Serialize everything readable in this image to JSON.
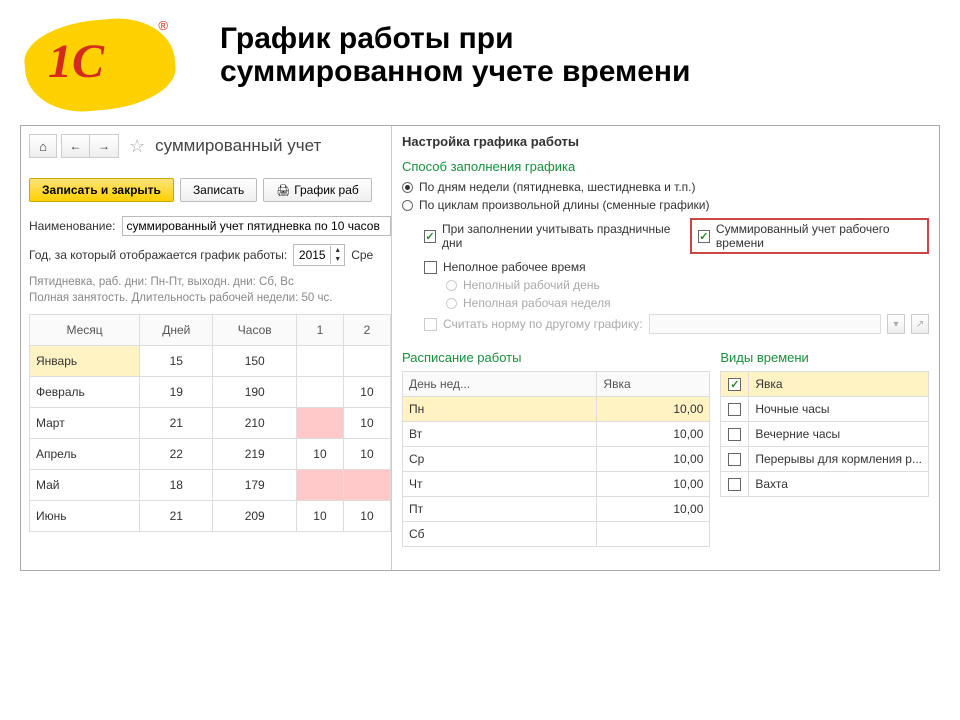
{
  "slide": {
    "title_line1": "График работы при",
    "title_line2": "суммированном учете времени",
    "logo_text": "1C",
    "logo_reg": "®"
  },
  "left": {
    "window_title": "суммированный учет",
    "btn_save_close": "Записать и закрыть",
    "btn_save": "Записать",
    "btn_schedule": "График раб",
    "label_name": "Наименование:",
    "name_value": "суммированный учет пятидневка по 10 часов",
    "label_year": "Год, за который отображается график работы:",
    "year_value": "2015",
    "label_avg": "Сре",
    "summary_line1": "Пятидневка, раб. дни: Пн-Пт, выходн. дни: Сб, Вс",
    "summary_line2": "Полная занятость. Длительность рабочей недели: 50 чс.",
    "table": {
      "headers": [
        "Месяц",
        "Дней",
        "Часов",
        "1",
        "2"
      ],
      "rows": [
        {
          "month": "Январь",
          "days": "15",
          "hours": "150",
          "c1": "",
          "c2": "",
          "m_yellow": true
        },
        {
          "month": "Февраль",
          "days": "19",
          "hours": "190",
          "c1": "",
          "c2": "10"
        },
        {
          "month": "Март",
          "days": "21",
          "hours": "210",
          "c1": "",
          "c2": "10",
          "c1_pink": true
        },
        {
          "month": "Апрель",
          "days": "22",
          "hours": "219",
          "c1": "10",
          "c2": "10"
        },
        {
          "month": "Май",
          "days": "18",
          "hours": "179",
          "c1": "",
          "c2": "",
          "c1_pink": true,
          "c2_pink": true
        },
        {
          "month": "Июнь",
          "days": "21",
          "hours": "209",
          "c1": "10",
          "c2": "10"
        }
      ]
    }
  },
  "right": {
    "title": "Настройка графика работы",
    "section_fill": "Способ заполнения графика",
    "radio_week": "По дням недели (пятидневка, шестидневка и т.п.)",
    "radio_cycle": "По циклам произвольной длины (сменные графики)",
    "chk_holidays": "При заполнении учитывать праздничные дни",
    "chk_summed": "Суммированный учет рабочего времени",
    "chk_parttime": "Неполное рабочее время",
    "radio_partday": "Неполный рабочий день",
    "radio_partweek": "Неполная рабочая неделя",
    "chk_norm": "Считать норму по другому графику:",
    "section_schedule": "Расписание работы",
    "sched_headers": [
      "День нед...",
      "Явка"
    ],
    "sched_rows": [
      {
        "day": "Пн",
        "val": "10,00",
        "sel": true
      },
      {
        "day": "Вт",
        "val": "10,00"
      },
      {
        "day": "Ср",
        "val": "10,00"
      },
      {
        "day": "Чт",
        "val": "10,00"
      },
      {
        "day": "Пт",
        "val": "10,00"
      },
      {
        "day": "Сб",
        "val": ""
      }
    ],
    "section_types": "Виды времени",
    "types": [
      {
        "label": "Явка",
        "checked": true
      },
      {
        "label": "Ночные часы",
        "checked": false
      },
      {
        "label": "Вечерние часы",
        "checked": false
      },
      {
        "label": "Перерывы для кормления р...",
        "checked": false
      },
      {
        "label": "Вахта",
        "checked": false
      }
    ]
  }
}
